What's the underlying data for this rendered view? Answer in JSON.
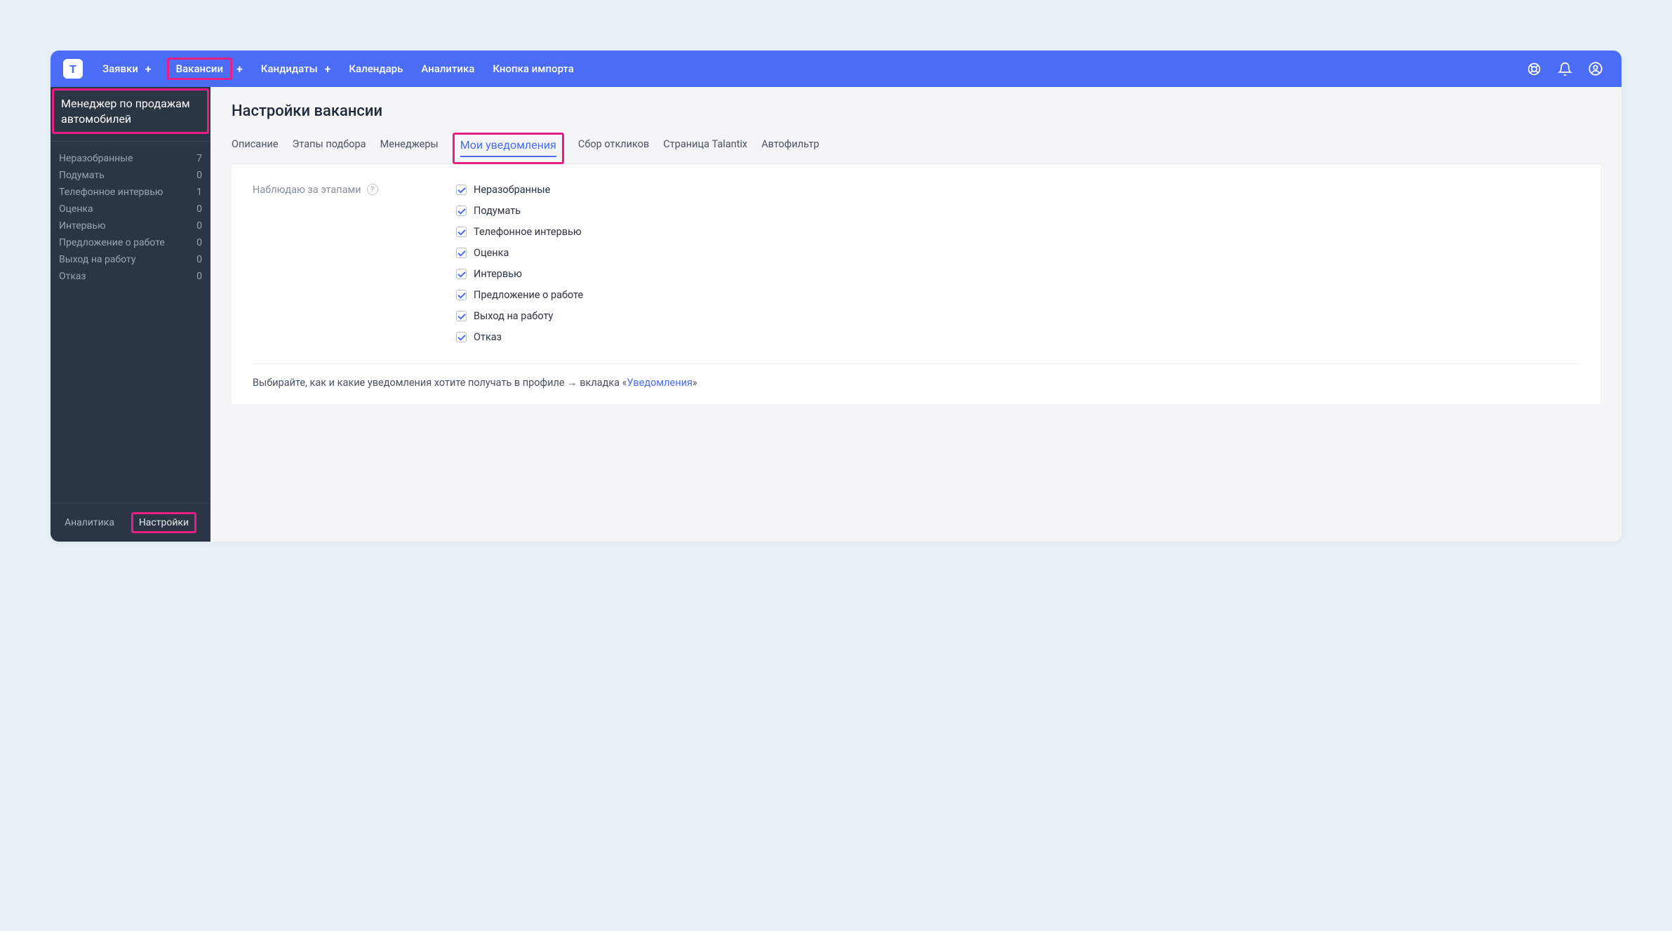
{
  "nav": {
    "items": [
      {
        "label": "Заявки",
        "plus": true,
        "active": false
      },
      {
        "label": "Вакансии",
        "plus": true,
        "active": true
      },
      {
        "label": "Кандидаты",
        "plus": true,
        "active": false
      },
      {
        "label": "Календарь",
        "plus": false,
        "active": false
      },
      {
        "label": "Аналитика",
        "plus": false,
        "active": false
      },
      {
        "label": "Кнопка импорта",
        "plus": false,
        "active": false
      }
    ]
  },
  "sidebar": {
    "vacancy_title": "Менеджер по продажам автомобилей",
    "stages": [
      {
        "label": "Неразобранные",
        "count": "7"
      },
      {
        "label": "Подумать",
        "count": "0"
      },
      {
        "label": "Телефонное интервью",
        "count": "1"
      },
      {
        "label": "Оценка",
        "count": "0"
      },
      {
        "label": "Интервью",
        "count": "0"
      },
      {
        "label": "Предложение о работе",
        "count": "0"
      },
      {
        "label": "Выход на работу",
        "count": "0"
      },
      {
        "label": "Отказ",
        "count": "0"
      }
    ],
    "bottom": {
      "analytics": "Аналитика",
      "settings": "Настройки"
    }
  },
  "content": {
    "title": "Настройки вакансии",
    "tabs": [
      {
        "label": "Описание"
      },
      {
        "label": "Этапы подбора"
      },
      {
        "label": "Менеджеры"
      },
      {
        "label": "Мои уведомления",
        "active": true
      },
      {
        "label": "Сбор откликов"
      },
      {
        "label": "Страница Talantix"
      },
      {
        "label": "Автофильтр"
      }
    ],
    "form_label": "Наблюдаю за этапами",
    "help_q": "?",
    "checkboxes": [
      {
        "label": "Неразобранные",
        "checked": true
      },
      {
        "label": "Подумать",
        "checked": true
      },
      {
        "label": "Телефонное интервью",
        "checked": true
      },
      {
        "label": "Оценка",
        "checked": true
      },
      {
        "label": "Интервью",
        "checked": true
      },
      {
        "label": "Предложение о работе",
        "checked": true
      },
      {
        "label": "Выход на работу",
        "checked": true
      },
      {
        "label": "Отказ",
        "checked": true
      }
    ],
    "help_text_pre": "Выбирайте, как и какие уведомления хотите получать в профиле → вкладка «",
    "help_link": "Уведомления",
    "help_text_post": "»"
  }
}
